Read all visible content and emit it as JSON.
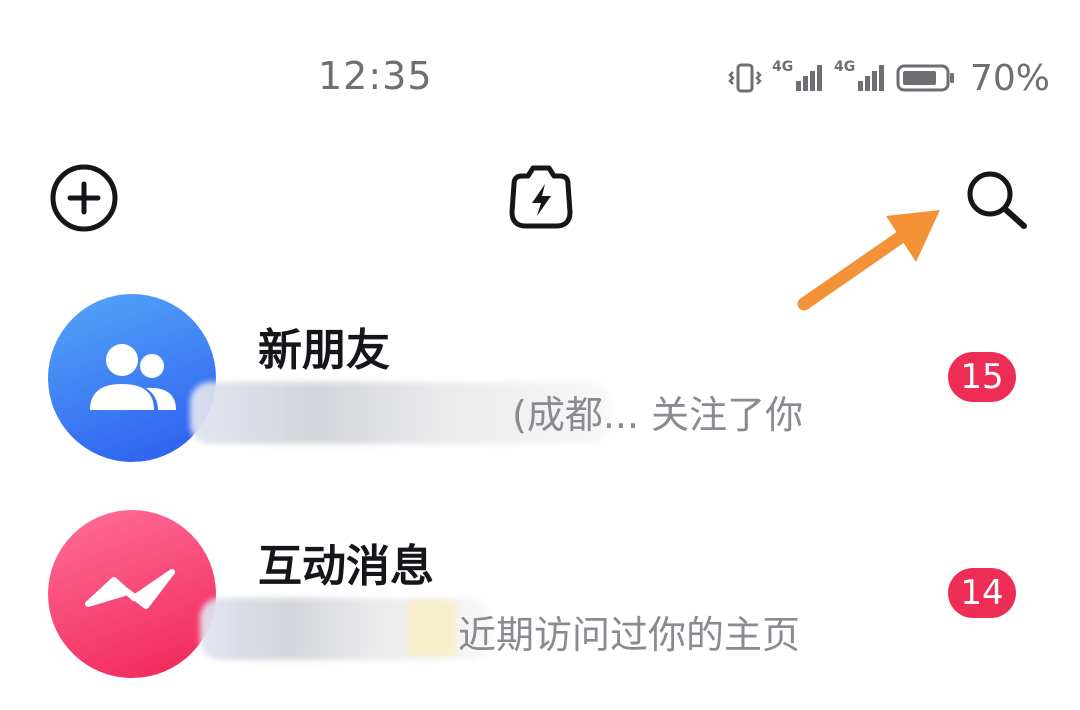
{
  "status_bar": {
    "time": "12:35",
    "network_1": "4G",
    "network_2": "4G",
    "battery_percent": "70%"
  },
  "toolbar": {
    "add_icon": "plus-circle-icon",
    "center_icon": "flash-camera-icon",
    "search_icon": "search-icon",
    "annotation_arrow_color": "#f39237"
  },
  "messages": [
    {
      "title": "新朋友",
      "subtitle_visible": "(成都... 关注了你",
      "badge": "15",
      "avatar_icon": "friends-icon",
      "avatar_color_top": "#4b9bf6",
      "avatar_color_bottom": "#2f5ff0"
    },
    {
      "title": "互动消息",
      "subtitle_visible": "近期访问过你的主页",
      "badge": "14",
      "avatar_icon": "lightning-chat-icon",
      "avatar_color_top": "#ff5f8f",
      "avatar_color_bottom": "#f2265a"
    }
  ],
  "colors": {
    "badge": "#ee2d55",
    "text_primary": "#16161a",
    "text_secondary": "#8a8a90"
  }
}
